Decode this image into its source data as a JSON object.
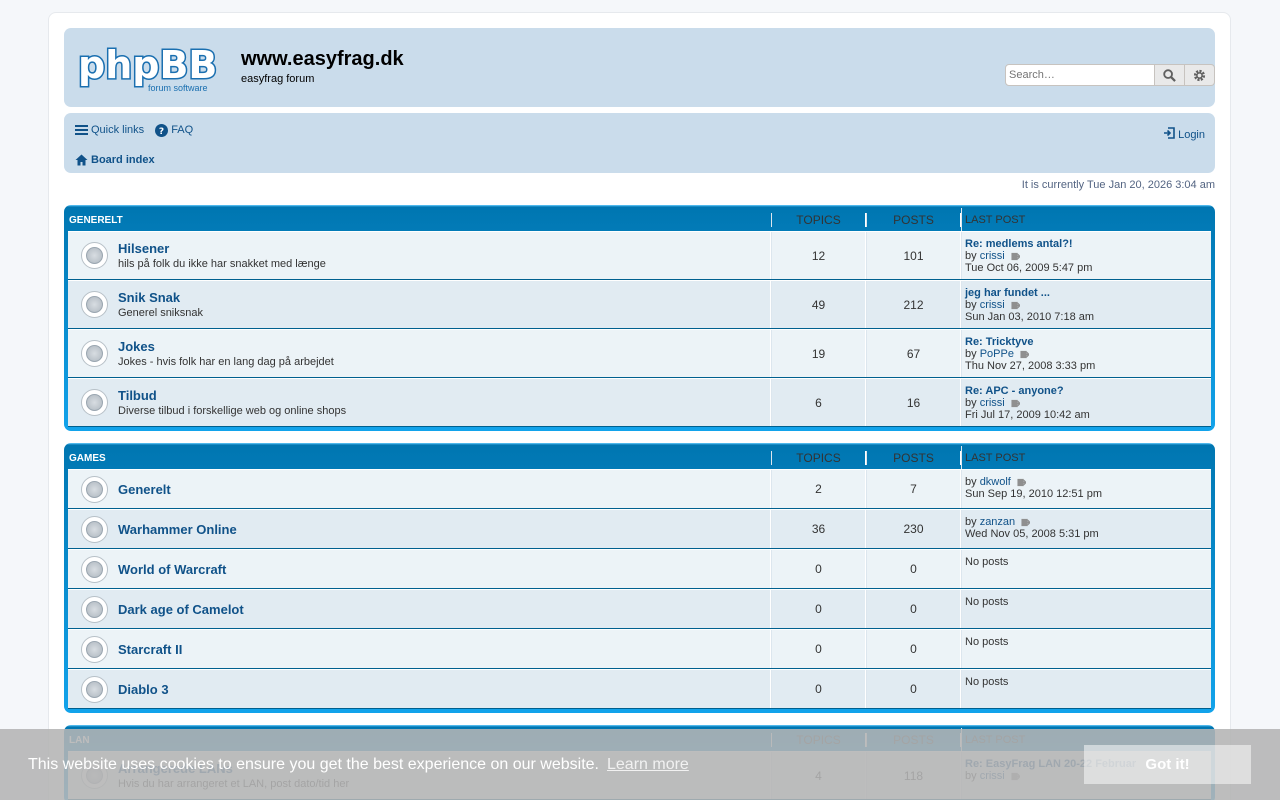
{
  "header": {
    "site_title": "www.easyfrag.dk",
    "site_desc": "easyfrag forum",
    "search_placeholder": "Search…"
  },
  "nav": {
    "quick_links": "Quick links",
    "faq": "FAQ",
    "login": "Login",
    "board_index": "Board index"
  },
  "current_time": "It is currently Tue Jan 20, 2026 3:04 am",
  "columns": {
    "topics": "TOPICS",
    "posts": "POSTS",
    "last_post": "LAST POST"
  },
  "categories": [
    {
      "name": "GENERELT",
      "forums": [
        {
          "title": "Hilsener",
          "desc": "hils på folk du ikke har snakket med længe",
          "topics": "12",
          "posts": "101",
          "last_title": "Re: medlems antal?!",
          "by": "by",
          "author": "crissi",
          "date": "Tue Oct 06, 2009 5:47 pm"
        },
        {
          "title": "Snik Snak",
          "desc": "Generel sniksnak",
          "topics": "49",
          "posts": "212",
          "last_title": "jeg har fundet ...",
          "by": "by",
          "author": "crissi",
          "date": "Sun Jan 03, 2010 7:18 am"
        },
        {
          "title": "Jokes",
          "desc": "Jokes - hvis folk har en lang dag på arbejdet",
          "topics": "19",
          "posts": "67",
          "last_title": "Re: Tricktyve",
          "by": "by",
          "author": "PoPPe",
          "date": "Thu Nov 27, 2008 3:33 pm"
        },
        {
          "title": "Tilbud",
          "desc": "Diverse tilbud i forskellige web og online shops",
          "topics": "6",
          "posts": "16",
          "last_title": "Re: APC - anyone?",
          "by": "by",
          "author": "crissi",
          "date": "Fri Jul 17, 2009 10:42 am"
        }
      ]
    },
    {
      "name": "GAMES",
      "forums": [
        {
          "title": "Generelt",
          "desc": "",
          "topics": "2",
          "posts": "7",
          "last_title": "",
          "by": "by",
          "author": "dkwolf",
          "date": "Sun Sep 19, 2010 12:51 pm"
        },
        {
          "title": "Warhammer Online",
          "desc": "",
          "topics": "36",
          "posts": "230",
          "last_title": "",
          "by": "by",
          "author": "zanzan",
          "date": "Wed Nov 05, 2008 5:31 pm"
        },
        {
          "title": "World of Warcraft",
          "desc": "",
          "topics": "0",
          "posts": "0",
          "no_posts": "No posts"
        },
        {
          "title": "Dark age of Camelot",
          "desc": "",
          "topics": "0",
          "posts": "0",
          "no_posts": "No posts"
        },
        {
          "title": "Starcraft II",
          "desc": "",
          "topics": "0",
          "posts": "0",
          "no_posts": "No posts"
        },
        {
          "title": "Diablo 3",
          "desc": "",
          "topics": "0",
          "posts": "0",
          "no_posts": "No posts"
        }
      ]
    },
    {
      "name": "LAN",
      "forums": [
        {
          "title": "Arrangerede LANs",
          "desc": "Hvis du har arrangeret et LAN, post dato/tid her",
          "topics": "4",
          "posts": "118",
          "last_title": "Re: EasyFrag LAN 20-22 Februar",
          "by": "by",
          "author": "crissi",
          "date": ""
        }
      ]
    }
  ],
  "cookie": {
    "message": "This website uses cookies to ensure you get the best experience on our website.",
    "learn_more": "Learn more",
    "button": "Got it!"
  },
  "colors": {
    "link": "#105289",
    "header_bg": "#cadceb",
    "forum_bar": "#12a3eb"
  },
  "icons": [
    "phpbb-logo",
    "search-icon",
    "gear-icon",
    "bars-icon",
    "question-icon",
    "login-icon",
    "home-icon",
    "forum-read-icon",
    "view-latest-post-icon"
  ]
}
